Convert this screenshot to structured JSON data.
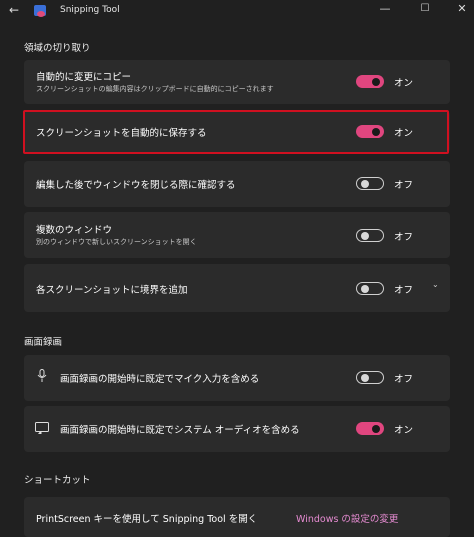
{
  "window": {
    "back_glyph": "←",
    "title": "Snipping Tool",
    "minimize_glyph": "—",
    "maximize_glyph": "☐",
    "close_glyph": "✕"
  },
  "sections": {
    "region": "領域の切り取り",
    "recording": "画面録画",
    "shortcuts": "ショートカット"
  },
  "settings": [
    {
      "label": "自動的に変更にコピー",
      "sub": "スクリーンショットの編集内容はクリップボードに自動的にコピーされます",
      "state": "オン",
      "on": true
    },
    {
      "label": "スクリーンショットを自動的に保存する",
      "state": "オン",
      "on": true
    },
    {
      "label": "編集した後でウィンドウを閉じる際に確認する",
      "state": "オフ",
      "on": false
    },
    {
      "label": "複数のウィンドウ",
      "sub": "別のウィンドウで新しいスクリーンショットを開く",
      "state": "オフ",
      "on": false
    },
    {
      "label": "各スクリーンショットに境界を追加",
      "state": "オフ",
      "on": false,
      "expand_glyph": "⌄"
    }
  ],
  "recording": [
    {
      "label": "画面録画の開始時に既定でマイク入力を含める",
      "icon": "microphone-icon",
      "state": "オフ",
      "on": false
    },
    {
      "label": "画面録画の開始時に既定でシステム オーディオを含める",
      "icon": "speaker-screen-icon",
      "state": "オン",
      "on": true
    }
  ],
  "shortcut": {
    "label": "PrintScreen キーを使用して Snipping Tool を開く",
    "link": "Windows の設定の変更"
  },
  "colors": {
    "accent": "#e0467f",
    "highlight_border": "#d01020",
    "link": "#e58bd1"
  }
}
